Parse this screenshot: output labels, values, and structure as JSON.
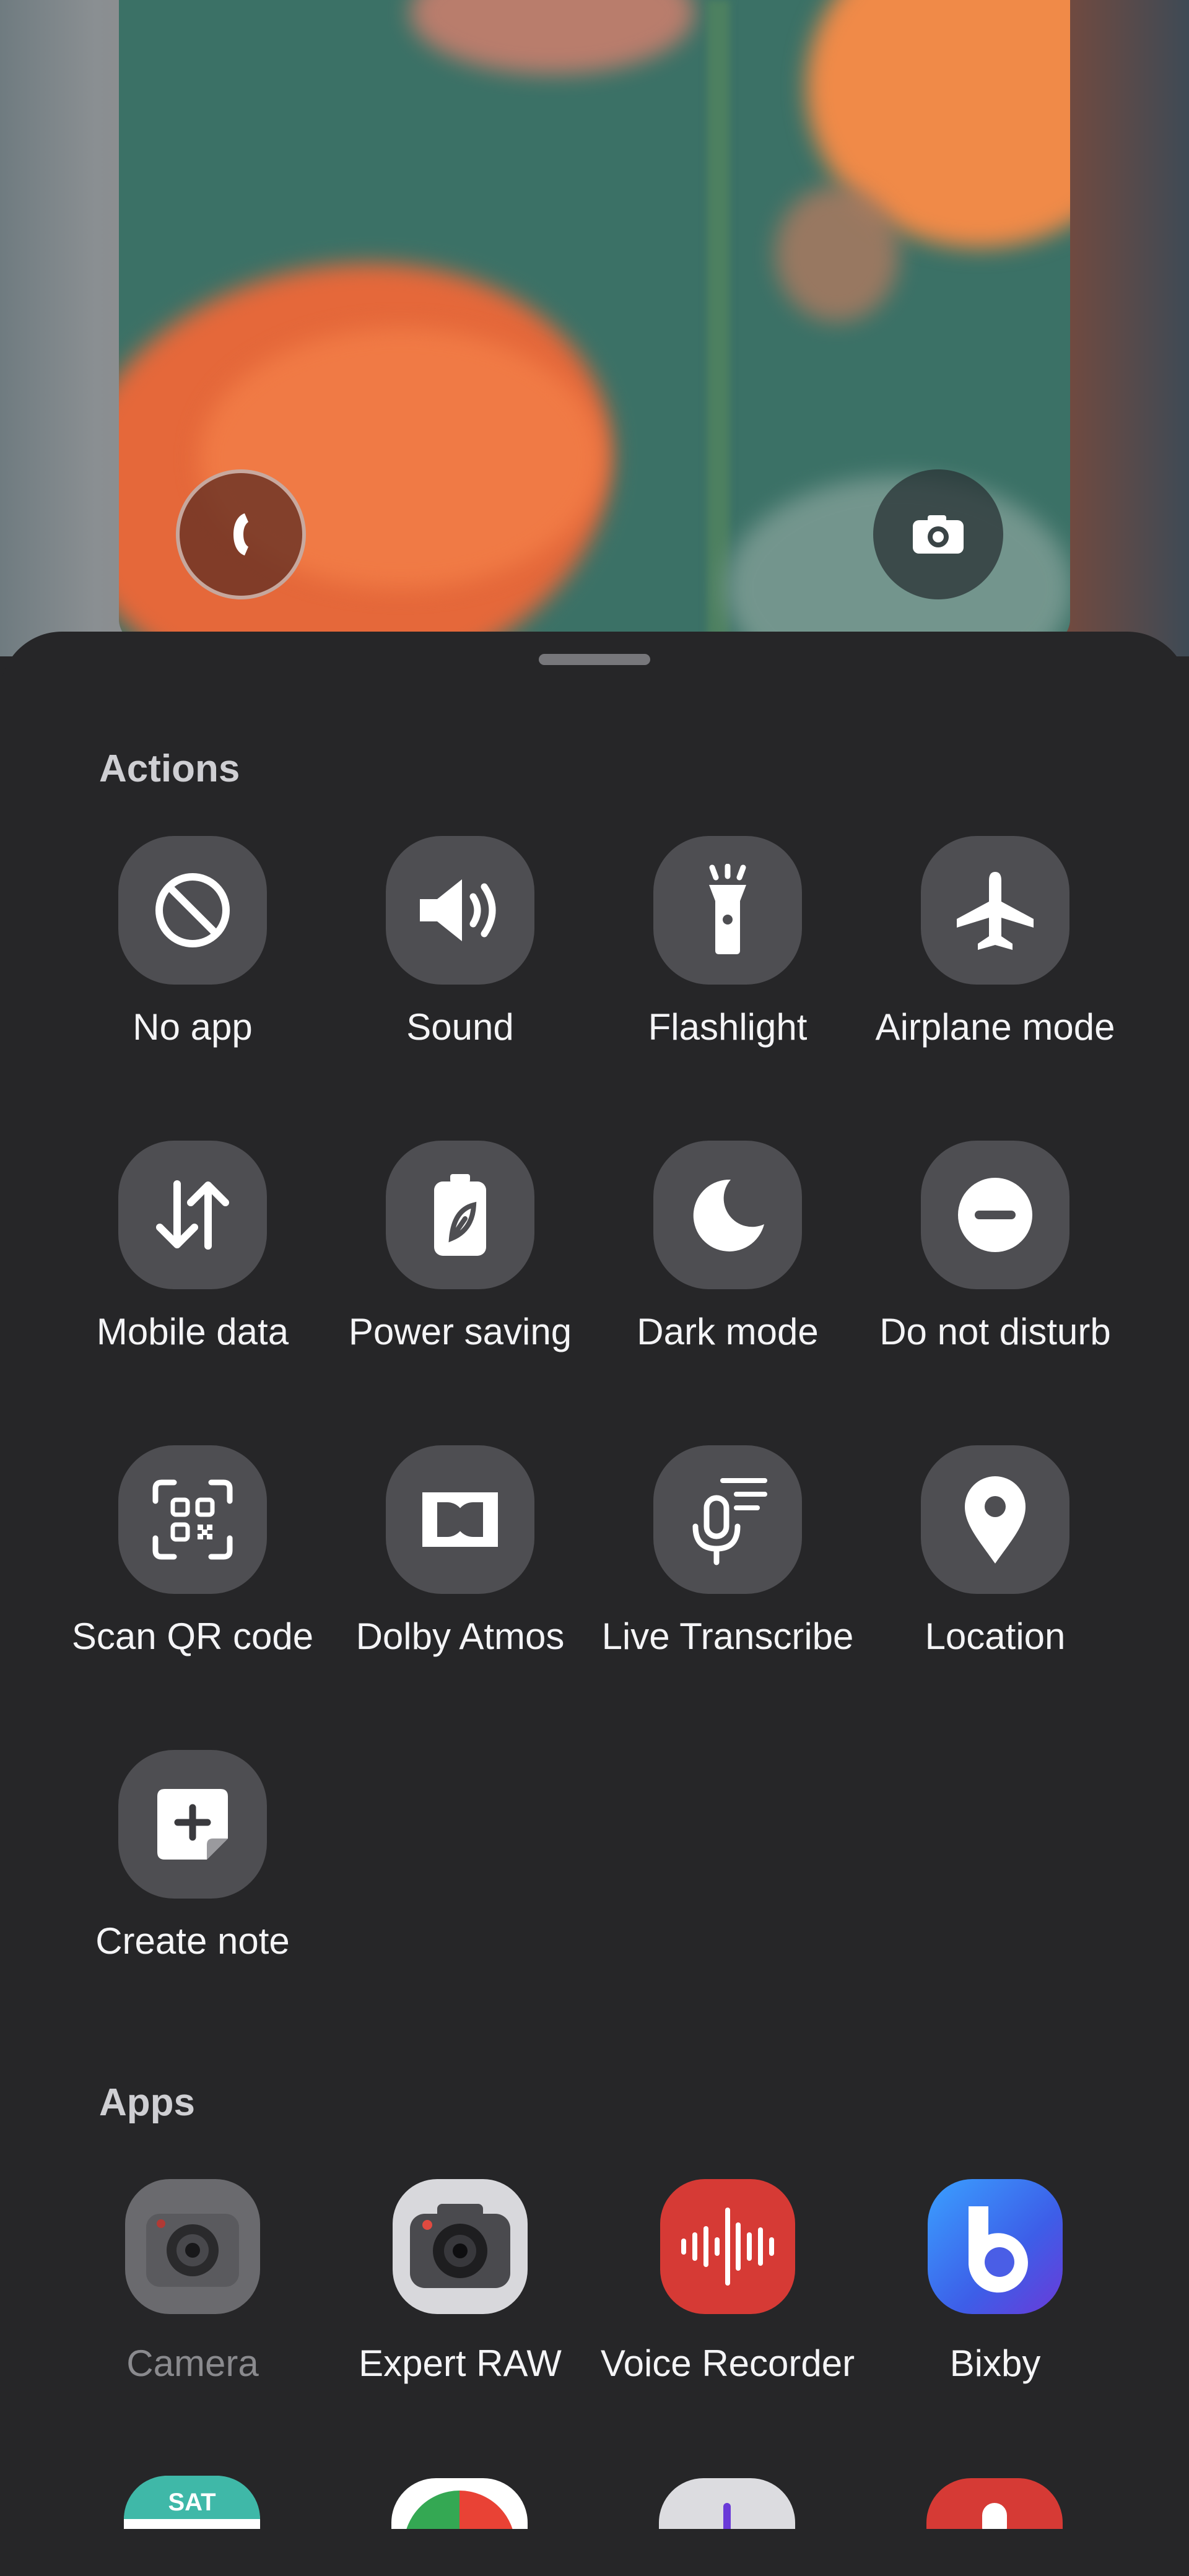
{
  "sections": {
    "actions_title": "Actions",
    "apps_title": "Apps"
  },
  "actions": [
    {
      "label": "No app",
      "icon": "no-app-icon"
    },
    {
      "label": "Sound",
      "icon": "sound-icon"
    },
    {
      "label": "Flashlight",
      "icon": "flashlight-icon"
    },
    {
      "label": "Airplane mode",
      "icon": "airplane-icon"
    },
    {
      "label": "Mobile data",
      "icon": "mobile-data-icon"
    },
    {
      "label": "Power saving",
      "icon": "power-saving-icon"
    },
    {
      "label": "Dark mode",
      "icon": "dark-mode-icon"
    },
    {
      "label": "Do not disturb",
      "icon": "do-not-disturb-icon"
    },
    {
      "label": "Scan QR code",
      "icon": "qr-code-icon"
    },
    {
      "label": "Dolby Atmos",
      "icon": "dolby-icon"
    },
    {
      "label": "Live Transcribe",
      "icon": "live-transcribe-icon"
    },
    {
      "label": "Location",
      "icon": "location-icon"
    },
    {
      "label": "Create note",
      "icon": "create-note-icon"
    }
  ],
  "apps": [
    {
      "label": "Camera",
      "icon": "camera-app-icon",
      "dimmed": true
    },
    {
      "label": "Expert RAW",
      "icon": "expert-raw-icon"
    },
    {
      "label": "Voice Recorder",
      "icon": "voice-recorder-icon"
    },
    {
      "label": "Bixby",
      "icon": "bixby-icon"
    }
  ],
  "apps_partial_row": {
    "calendar_day": "SAT"
  },
  "colors": {
    "sheet_bg": "#262628",
    "tile_bg": "#4e4e52",
    "voice_recorder": "#d63a35",
    "bixby": "#3d5ee8",
    "calendar": "#3fb8a8"
  }
}
